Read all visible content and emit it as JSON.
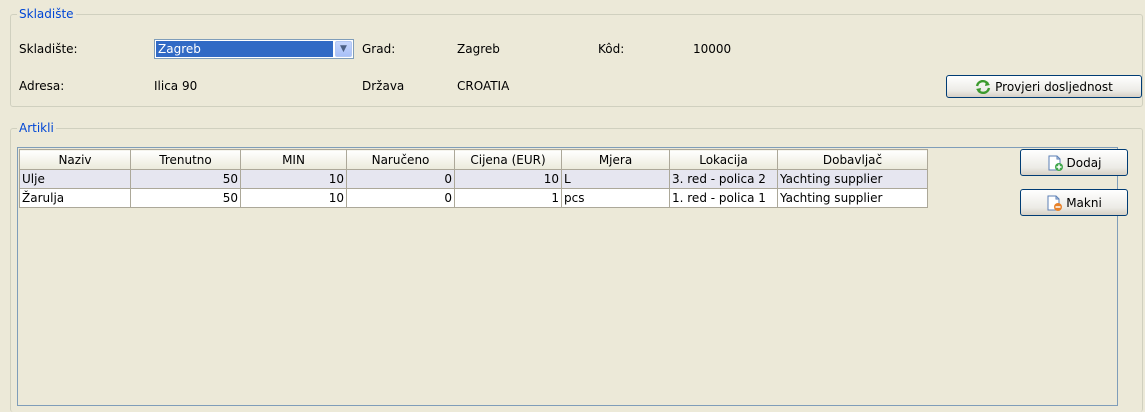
{
  "warehouse_group": {
    "title": "Skladište",
    "warehouse_label": "Skladište:",
    "warehouse_value": "Zagreb",
    "city_label": "Grad:",
    "city_value": "Zagreb",
    "code_label": "Kôd:",
    "code_value": "10000",
    "address_label": "Adresa:",
    "address_value": "Ilica 90",
    "country_label": "Država",
    "country_value": "CROATIA",
    "check_button": "Provjeri dosljednost",
    "check_icon": "refresh-arrows-icon"
  },
  "articles_group": {
    "title": "Artikli",
    "columns": [
      "Naziv",
      "Trenutno",
      "MIN",
      "Naručeno",
      "Cijena (EUR)",
      "Mjera",
      "Lokacija",
      "Dobavljač"
    ],
    "rows": [
      [
        "Ulje",
        "50",
        "10",
        "0",
        "10",
        "L",
        "3. red - polica 2",
        "Yachting supplier"
      ],
      [
        "Žarulja",
        "50",
        "10",
        "0",
        "1",
        "pcs",
        "1. red - polica 1",
        "Yachting supplier"
      ]
    ],
    "add_button": "Dodaj",
    "add_icon": "document-add-icon",
    "remove_button": "Makni",
    "remove_icon": "document-remove-icon"
  },
  "colors": {
    "group_title": "#0046d5",
    "selection": "#316ac5",
    "window_bg": "#ece9d8"
  }
}
